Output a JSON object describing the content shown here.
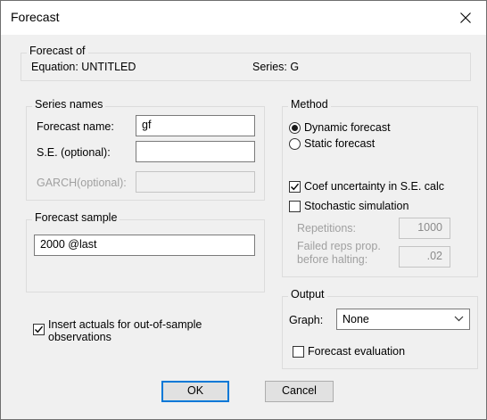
{
  "window": {
    "title": "Forecast"
  },
  "forecast_of": {
    "group_label": "Forecast of",
    "equation_text": "Equation: UNTITLED",
    "series_text": "Series: G"
  },
  "series_names": {
    "group_label": "Series names",
    "forecast_name": {
      "label": "Forecast name:",
      "value": "gf"
    },
    "se": {
      "label": "S.E. (optional):",
      "value": ""
    },
    "garch": {
      "label": "GARCH(optional):",
      "value": ""
    }
  },
  "forecast_sample": {
    "group_label": "Forecast sample",
    "value": "2000 @last"
  },
  "insert_actuals": {
    "checked": true,
    "label_line1": "Insert actuals for out-of-sample",
    "label_line2": "observations"
  },
  "method": {
    "group_label": "Method",
    "dynamic_label": "Dynamic forecast",
    "static_label": "Static forecast",
    "selected": "dynamic",
    "coef_uncertainty": {
      "label": "Coef uncertainty in S.E. calc",
      "checked": true
    },
    "stochastic": {
      "label": "Stochastic simulation",
      "checked": false
    },
    "repetitions": {
      "label": "Repetitions:",
      "value": "1000"
    },
    "failed_reps": {
      "label_line1": "Failed reps prop.",
      "label_line2": "before halting:",
      "value": ".02"
    }
  },
  "output": {
    "group_label": "Output",
    "graph_label": "Graph:",
    "graph_value": "None",
    "forecast_eval": {
      "label": "Forecast evaluation",
      "checked": false
    }
  },
  "buttons": {
    "ok": "OK",
    "cancel": "Cancel"
  }
}
